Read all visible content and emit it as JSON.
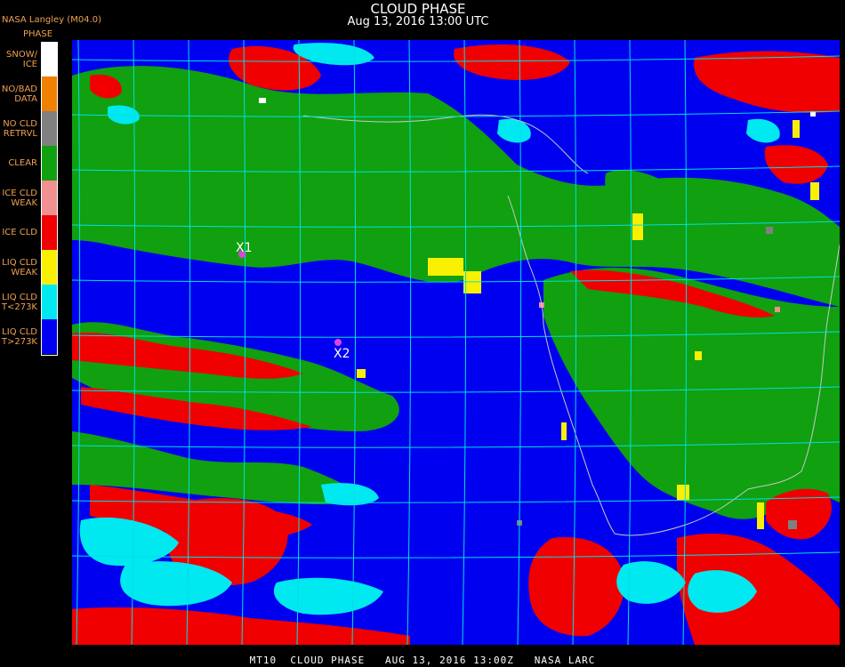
{
  "header": {
    "title": "CLOUD PHASE",
    "subtitle": "Aug 13, 2016 13:00 UTC",
    "source": "NASA Langley (M04.0)"
  },
  "legend": {
    "title": "PHASE",
    "items": [
      {
        "label": "SNOW/\nICE",
        "color": "#ffffff"
      },
      {
        "label": "NO/BAD\nDATA",
        "color": "#f08000"
      },
      {
        "label": "NO CLD\nRETRVL",
        "color": "#808080"
      },
      {
        "label": "CLEAR",
        "color": "#10a010"
      },
      {
        "label": "ICE CLD\nWEAK",
        "color": "#f09090"
      },
      {
        "label": "ICE CLD",
        "color": "#f00000"
      },
      {
        "label": "LIQ CLD\nWEAK",
        "color": "#f8f000"
      },
      {
        "label": "LIQ CLD\nT<273K",
        "color": "#00e8f0"
      },
      {
        "label": "LIQ CLD\nT>273K",
        "color": "#0000f0"
      }
    ]
  },
  "markers": [
    {
      "label": "X1"
    },
    {
      "label": "X2"
    }
  ],
  "colors": {
    "grid": "#00e0e0",
    "coast": "#c8c8c8",
    "marker": "#e040e0"
  },
  "footer": "MT10  CLOUD PHASE   AUG 13, 2016 13:00Z   NASA LARC"
}
